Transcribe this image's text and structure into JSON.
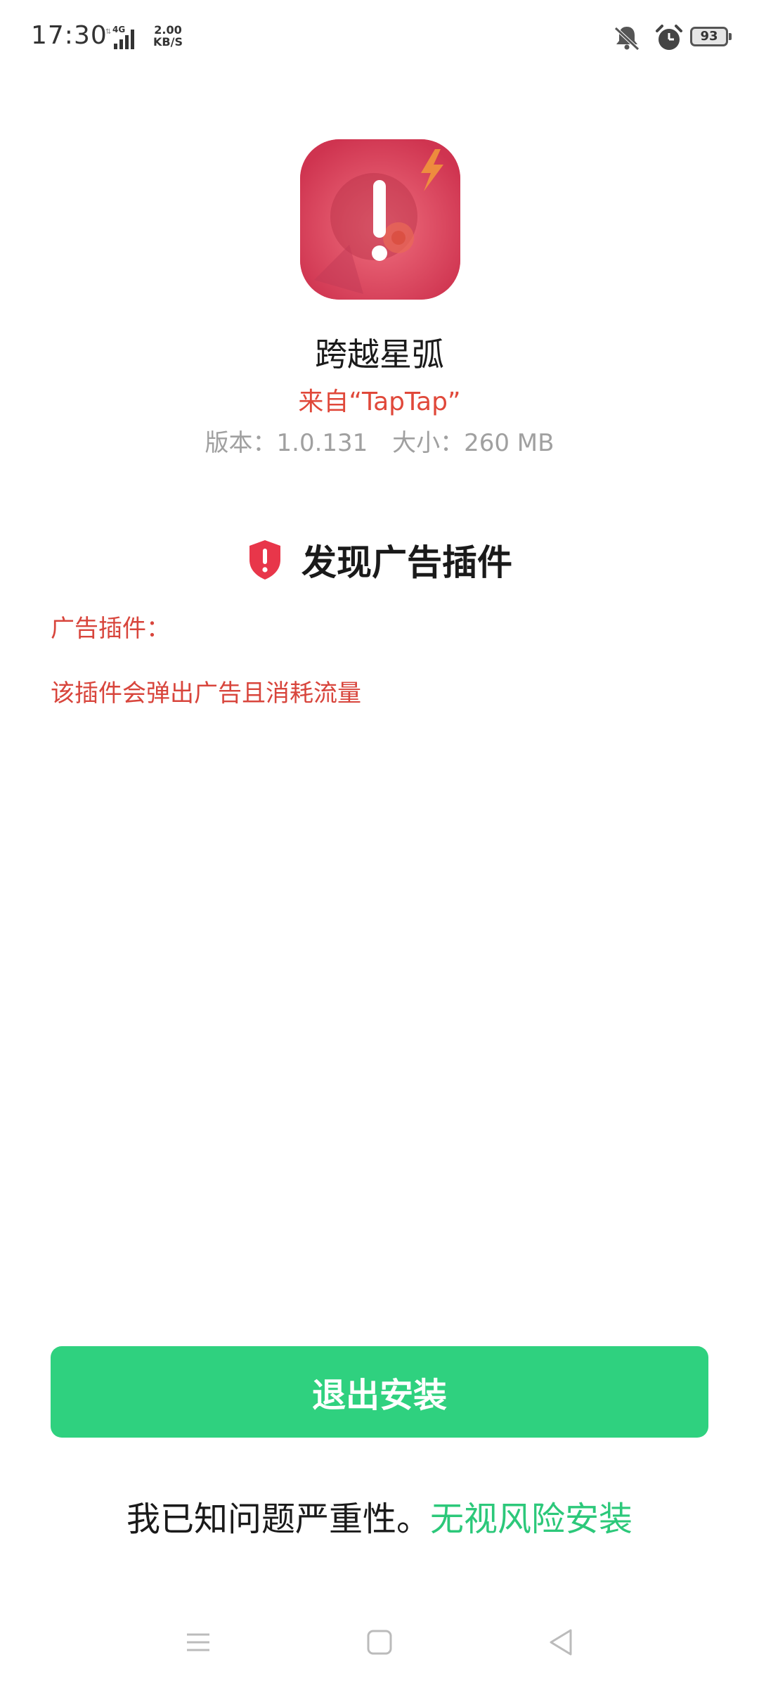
{
  "status_bar": {
    "time": "17:30",
    "network_type": "4G",
    "net_speed_value": "2.00",
    "net_speed_unit": "KB/S",
    "battery_level": "93",
    "icons": [
      "signal-icon",
      "silent-icon",
      "alarm-icon",
      "battery-icon"
    ]
  },
  "app": {
    "name": "跨越星弧",
    "source": "来自“TapTap”",
    "version_text": "版本：1.0.131",
    "size_text": "大小：260 MB",
    "icon": "app-warning-icon"
  },
  "warning": {
    "title": "发现广告插件",
    "icon": "shield-alert-icon",
    "plugin_label": "广告插件：",
    "plugin_description": "该插件会弹出广告且消耗流量"
  },
  "actions": {
    "exit_label": "退出安装",
    "acknowledge_text": "我已知问题严重性。",
    "ignore_risk_label": "无视风险安装"
  },
  "nav_bar": {
    "items": [
      "menu-icon",
      "home-icon",
      "back-icon"
    ]
  },
  "colors": {
    "accent_green": "#2fd17f",
    "warning_red": "#e0483a",
    "shield_red": "#e8364a"
  }
}
